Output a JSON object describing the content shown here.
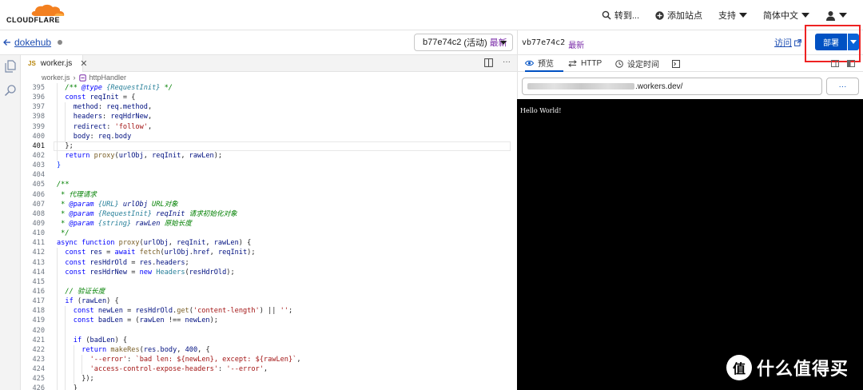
{
  "brand": {
    "name": "CLOUDFLARE",
    "accent": "#f38020"
  },
  "topnav": {
    "goto_label": "转到...",
    "add_site_label": "添加站点",
    "support_label": "支持",
    "language_label": "简体中文"
  },
  "worker": {
    "name": "dokehub",
    "version_select": {
      "version": "b77e74c2",
      "status": "(活动)",
      "latest": "最新"
    }
  },
  "preview_header": {
    "version": "vb77e74c2",
    "latest": "最新",
    "visit_label": "访问",
    "deploy_label": "部署"
  },
  "editor": {
    "tab_label": "worker.js",
    "tab_lang": "JS",
    "breadcrumb_file": "worker.js",
    "breadcrumb_symbol": "httpHandler"
  },
  "preview": {
    "tabs": [
      {
        "label": "预览",
        "icon": "eye-icon",
        "active": true
      },
      {
        "label": "HTTP",
        "icon": "arrows-icon",
        "active": false
      },
      {
        "label": "设定时间",
        "icon": "clock-icon",
        "active": false
      },
      {
        "label": "",
        "icon": "terminal-icon",
        "active": false
      }
    ],
    "url_suffix": ".workers.dev/",
    "more_label": "···",
    "output": "Hello World!"
  },
  "code_lines": [
    {
      "n": "395",
      "i": 1,
      "h": "<span class=\"cm\">/** </span><span class=\"cmk\">@type</span><span class=\"cm\"> </span><span class=\"ty\">{RequestInit}</span><span class=\"cm\"> */</span>"
    },
    {
      "n": "396",
      "i": 1,
      "h": "<span class=\"kw\">const</span> <span class=\"vr\">reqInit</span> = {"
    },
    {
      "n": "397",
      "i": 2,
      "h": "<span class=\"vr\">method</span>: <span class=\"vr\">req</span>.<span class=\"vr\">method</span>,"
    },
    {
      "n": "398",
      "i": 2,
      "h": "<span class=\"vr\">headers</span>: <span class=\"vr\">reqHdrNew</span>,"
    },
    {
      "n": "399",
      "i": 2,
      "h": "<span class=\"vr\">redirect</span>: <span class=\"st\">'follow'</span>,"
    },
    {
      "n": "400",
      "i": 2,
      "h": "<span class=\"vr\">body</span>: <span class=\"vr\">req</span>.<span class=\"vr\">body</span>"
    },
    {
      "n": "401",
      "i": 1,
      "h": "};",
      "active": true
    },
    {
      "n": "402",
      "i": 1,
      "h": "<span class=\"kw\">return</span> <span class=\"fn\">proxy</span>(<span class=\"vr\">urlObj</span>, <span class=\"vr\">reqInit</span>, <span class=\"vr\">rawLen</span>);"
    },
    {
      "n": "403",
      "i": 0,
      "h": "<span class=\"br\">}</span>"
    },
    {
      "n": "404",
      "i": 0,
      "h": ""
    },
    {
      "n": "405",
      "i": 0,
      "h": "<span class=\"cm\">/**</span>"
    },
    {
      "n": "406",
      "i": 0,
      "h": "<span class=\"cm\"> * 代理请求</span>"
    },
    {
      "n": "407",
      "i": 0,
      "h": "<span class=\"cm\"> * </span><span class=\"cmk\">@param</span><span class=\"cm\"> </span><span class=\"ty\">{URL}</span><span class=\"cm\"> </span><span class=\"vr\"><i>urlObj</i></span><span class=\"cm\"> URL对象</span>"
    },
    {
      "n": "408",
      "i": 0,
      "h": "<span class=\"cm\"> * </span><span class=\"cmk\">@param</span><span class=\"cm\"> </span><span class=\"ty\">{RequestInit}</span><span class=\"cm\"> </span><span class=\"vr\"><i>reqInit</i></span><span class=\"cm\"> 请求初始化对象</span>"
    },
    {
      "n": "409",
      "i": 0,
      "h": "<span class=\"cm\"> * </span><span class=\"cmk\">@param</span><span class=\"cm\"> </span><span class=\"ty\">{string}</span><span class=\"cm\"> </span><span class=\"vr\"><i>rawLen</i></span><span class=\"cm\"> 原始长度</span>"
    },
    {
      "n": "410",
      "i": 0,
      "h": "<span class=\"cm\"> */</span>"
    },
    {
      "n": "411",
      "i": 0,
      "h": "<span class=\"kw\">async</span> <span class=\"kw\">function</span> <span class=\"fn\">proxy</span>(<span class=\"vr\">urlObj</span>, <span class=\"vr\">reqInit</span>, <span class=\"vr\">rawLen</span>) {"
    },
    {
      "n": "412",
      "i": 1,
      "h": "<span class=\"kw\">const</span> <span class=\"vr\">res</span> = <span class=\"kw\">await</span> <span class=\"fn\">fetch</span>(<span class=\"vr\">urlObj</span>.<span class=\"vr\">href</span>, <span class=\"vr\">reqInit</span>);"
    },
    {
      "n": "413",
      "i": 1,
      "h": "<span class=\"kw\">const</span> <span class=\"vr\">resHdrOld</span> = <span class=\"vr\">res</span>.<span class=\"vr\">headers</span>;"
    },
    {
      "n": "414",
      "i": 1,
      "h": "<span class=\"kw\">const</span> <span class=\"vr\">resHdrNew</span> = <span class=\"kw\">new</span> <span class=\"cl\">Headers</span>(<span class=\"vr\">resHdrOld</span>);"
    },
    {
      "n": "415",
      "i": 1,
      "h": ""
    },
    {
      "n": "416",
      "i": 1,
      "h": "<span class=\"cm\">// 验证长度</span>"
    },
    {
      "n": "417",
      "i": 1,
      "h": "<span class=\"kw\">if</span> (<span class=\"vr\">rawLen</span>) {"
    },
    {
      "n": "418",
      "i": 2,
      "h": "<span class=\"kw\">const</span> <span class=\"vr\">newLen</span> = <span class=\"vr\">resHdrOld</span>.<span class=\"fn\">get</span>(<span class=\"st\">'content-length'</span>) || <span class=\"st\">''</span>;"
    },
    {
      "n": "419",
      "i": 2,
      "h": "<span class=\"kw\">const</span> <span class=\"vr\">badLen</span> = (<span class=\"vr\">rawLen</span> !== <span class=\"vr\">newLen</span>);"
    },
    {
      "n": "420",
      "i": 2,
      "h": ""
    },
    {
      "n": "421",
      "i": 2,
      "h": "<span class=\"kw\">if</span> (<span class=\"vr\">badLen</span>) {"
    },
    {
      "n": "422",
      "i": 3,
      "h": "<span class=\"kw\">return</span> <span class=\"fn\">makeRes</span>(<span class=\"vr\">res</span>.<span class=\"vr\">body</span>, <span class=\"vr\">400</span>, {"
    },
    {
      "n": "423",
      "i": 4,
      "h": "<span class=\"st\">'--error'</span>: <span class=\"st\">`bad len: ${newLen}, except: ${rawLen}`</span>,"
    },
    {
      "n": "424",
      "i": 4,
      "h": "<span class=\"st\">'access-control-expose-headers'</span>: <span class=\"st\">'--error'</span>,"
    },
    {
      "n": "425",
      "i": 3,
      "h": "});"
    },
    {
      "n": "426",
      "i": 2,
      "h": "}"
    }
  ],
  "watermark": {
    "text": "什么值得买",
    "badge": "值"
  }
}
